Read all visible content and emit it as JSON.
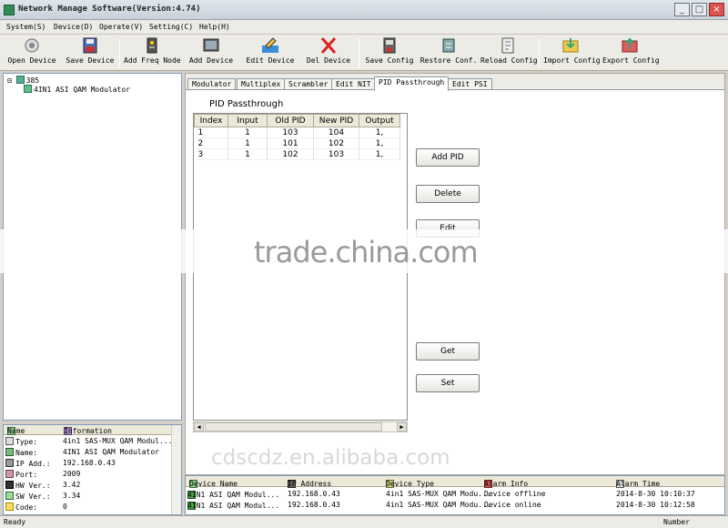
{
  "window": {
    "title": "Network Manage Software(Version:4.74)",
    "min": "_",
    "max": "□",
    "close": "×"
  },
  "menu": [
    "System(S)",
    "Device(D)",
    "Operate(V)",
    "Setting(C)",
    "Help(H)"
  ],
  "toolbar": [
    {
      "label": "Open Device",
      "icon": "open-device-icon"
    },
    {
      "label": "Save Device",
      "icon": "save-device-icon"
    },
    {
      "label": "Add Freq Node",
      "icon": "add-freq-node-icon"
    },
    {
      "label": "Add Device",
      "icon": "add-device-icon"
    },
    {
      "label": "Edit Device",
      "icon": "edit-device-icon"
    },
    {
      "label": "Del Device",
      "icon": "delete-device-icon"
    },
    {
      "label": "Save Config",
      "icon": "save-config-icon"
    },
    {
      "label": "Restore Conf.",
      "icon": "restore-config-icon"
    },
    {
      "label": "Reload Config",
      "icon": "reload-config-icon"
    },
    {
      "label": "Import Config",
      "icon": "import-config-icon"
    },
    {
      "label": "Export Config",
      "icon": "export-config-icon"
    }
  ],
  "tree": {
    "root": "385",
    "child": "4IN1 ASI QAM Modulator"
  },
  "info": {
    "headers": [
      "Name",
      "Information"
    ],
    "rows": [
      {
        "k": "Type:",
        "v": "4in1 SAS-MUX QAM Modul..."
      },
      {
        "k": "Name:",
        "v": "4IN1 ASI QAM Modulator"
      },
      {
        "k": "IP Add.:",
        "v": "192.168.0.43"
      },
      {
        "k": "Port:",
        "v": "2009"
      },
      {
        "k": "HW Ver.:",
        "v": "3.42"
      },
      {
        "k": "SW Ver.:",
        "v": "3.34"
      },
      {
        "k": "Code:",
        "v": "0"
      }
    ]
  },
  "tabs": [
    "Modulator",
    "Multiplex",
    "Scrambler",
    "Edit NIT",
    "PID Passthrough",
    "Edit PSI"
  ],
  "pid": {
    "title": "PID Passthrough",
    "columns": [
      "Index",
      "Input",
      "Old PID",
      "New PID",
      "Output"
    ],
    "rows": [
      [
        "1",
        "1",
        "103",
        "104",
        "1,"
      ],
      [
        "2",
        "1",
        "101",
        "102",
        "1,"
      ],
      [
        "3",
        "1",
        "102",
        "103",
        "1,"
      ]
    ],
    "buttons": {
      "add": "Add PID",
      "delete": "Delete",
      "edit": "Edit",
      "get": "Get",
      "set": "Set"
    }
  },
  "log": {
    "headers": [
      "Device Name",
      "IP Address",
      "Device Type",
      "Alarm Info",
      "Alarm Time"
    ],
    "rows": [
      [
        "4IN1 ASI QAM Modul...",
        "192.168.0.43",
        "4in1 SAS-MUX QAM Modu...",
        "Device offline",
        "2014-8-30 10:10:37"
      ],
      [
        "4IN1 ASI QAM Modul...",
        "192.168.0.43",
        "4in1 SAS-MUX QAM Modu...",
        "Device online",
        "2014-8-30 10:12:58"
      ]
    ]
  },
  "status": {
    "left": "Ready",
    "right": "Number"
  },
  "watermarks": {
    "center": "trade.china.com",
    "bottom": "cdscdz.en.alibaba.com"
  }
}
